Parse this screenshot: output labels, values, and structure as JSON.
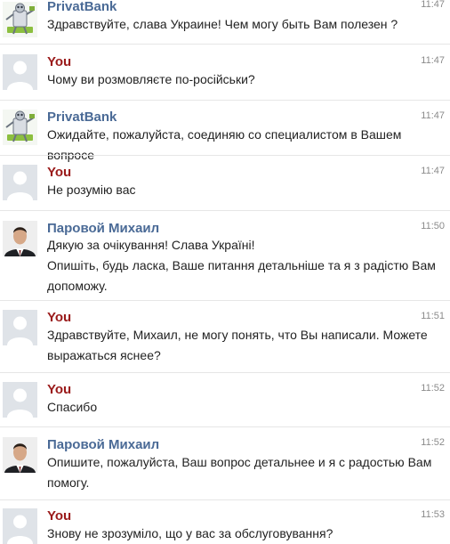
{
  "colors": {
    "bank_name": "#4a6a96",
    "you_name": "#9a1a1a",
    "operator_name": "#4a6a96",
    "timestamp": "#8b8b8b",
    "text": "#222222"
  },
  "messages": [
    {
      "sender": "PrivatBank",
      "avatar": "privatbank-bot-icon",
      "time": "11:47",
      "lines": [
        "Здравствуйте, слава Украине! Чем могу быть Вам полезен ?"
      ]
    },
    {
      "sender": "You",
      "avatar": "user-placeholder-icon",
      "time": "11:47",
      "lines": [
        "Чому ви розмовляєте по-російськи?"
      ]
    },
    {
      "sender": "PrivatBank",
      "avatar": "privatbank-bot-icon",
      "time": "11:47",
      "lines": [
        "Ожидайте, пожалуйста, соединяю со специалистом в Вашем вопросе"
      ]
    },
    {
      "sender": "You",
      "avatar": "user-placeholder-icon",
      "time": "11:47",
      "lines": [
        "Не розумію вас"
      ]
    },
    {
      "sender": "Паровой Михаил",
      "avatar": "operator-photo",
      "time": "11:50",
      "lines": [
        "Дякую за очікування! Слава Україні!",
        "Опишіть, будь ласка, Ваше питання детальніше та я з радістю Вам допоможу."
      ]
    },
    {
      "sender": "You",
      "avatar": "user-placeholder-icon",
      "time": "11:51",
      "lines": [
        "Здравствуйте, Михаил, не могу понять, что Вы написали. Можете выражаться яснее?"
      ]
    },
    {
      "sender": "You",
      "avatar": "user-placeholder-icon",
      "time": "11:52",
      "lines": [
        "Спасибо"
      ]
    },
    {
      "sender": "Паровой Михаил",
      "avatar": "operator-photo",
      "time": "11:52",
      "lines": [
        "Опишите, пожалуйста, Ваш вопрос детальнее и я с радостью Вам помогу."
      ]
    },
    {
      "sender": "You",
      "avatar": "user-placeholder-icon",
      "time": "11:53",
      "lines": [
        "Знову не зрозуміло, що у вас за обслуговування?"
      ]
    }
  ]
}
